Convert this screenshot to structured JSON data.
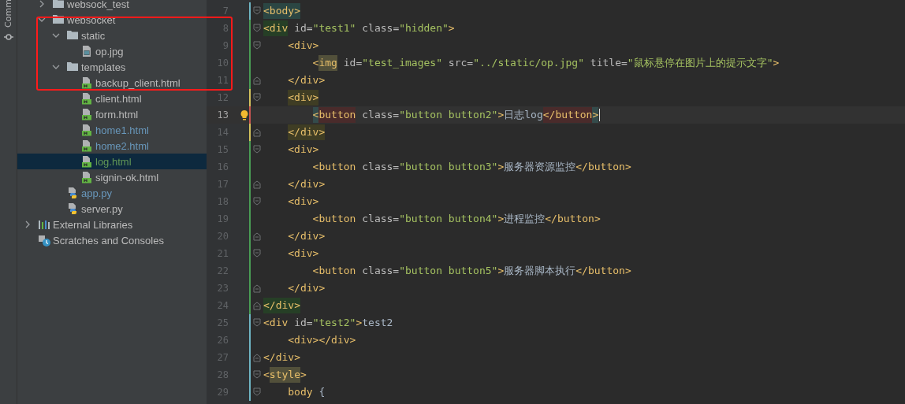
{
  "tool_strip": {
    "tab_label": "Comm"
  },
  "project_tree": {
    "items": [
      {
        "label": "websock_test",
        "kind": "folder",
        "expanded": false,
        "selected": false
      },
      {
        "label": "websocket",
        "kind": "folder",
        "expanded": true,
        "selected": false,
        "children": [
          {
            "label": "static",
            "kind": "folder",
            "expanded": true,
            "selected": false,
            "children": [
              {
                "label": "op.jpg",
                "kind": "image",
                "selected": false
              }
            ]
          },
          {
            "label": "templates",
            "kind": "folder",
            "expanded": true,
            "selected": false,
            "children": [
              {
                "label": "backup_client.html",
                "kind": "html",
                "selected": false
              },
              {
                "label": "client.html",
                "kind": "html",
                "selected": false
              },
              {
                "label": "form.html",
                "kind": "html",
                "selected": false
              },
              {
                "label": "home1.html",
                "kind": "html",
                "color": "#6897bb",
                "selected": false
              },
              {
                "label": "home2.html",
                "kind": "html",
                "color": "#6897bb",
                "selected": false
              },
              {
                "label": "log.html",
                "kind": "html",
                "color": "#629755",
                "selected": true
              },
              {
                "label": "signin-ok.html",
                "kind": "html",
                "selected": false
              }
            ]
          },
          {
            "label": "app.py",
            "kind": "python",
            "color": "#6897bb",
            "selected": false
          },
          {
            "label": "server.py",
            "kind": "python",
            "selected": false
          }
        ]
      },
      {
        "label": "External Libraries",
        "kind": "libraries",
        "expanded": false,
        "selected": false
      },
      {
        "label": "Scratches and Consoles",
        "kind": "scratches",
        "selected": false
      }
    ]
  },
  "annotation": {
    "kind": "rectangle"
  },
  "editor": {
    "lines": [
      {
        "number": "7",
        "color": "#6fb5c4",
        "fold_start": true,
        "current": false,
        "tokens": [
          {
            "kind": "tag",
            "s": "<body>",
            "color": "#2b4643"
          }
        ]
      },
      {
        "number": "8",
        "color": "#499c54",
        "fold_start": true,
        "current": false,
        "tokens": [
          {
            "kind": "tag",
            "s": "<div",
            "color": "#263f26"
          },
          {
            "kind": "attr",
            "s": " id="
          },
          {
            "kind": "str",
            "s": "\"test1\""
          },
          {
            "kind": "attr",
            "s": " class="
          },
          {
            "kind": "str",
            "s": "\"hidden\""
          },
          {
            "kind": "tag",
            "s": ">"
          }
        ],
        "children": [
          {
            "number": "9",
            "color": "#499c54",
            "fold_start": true,
            "current": false,
            "tokens": [
              {
                "kind": "tag",
                "s": "<div>"
              }
            ],
            "children": [
              {
                "number": "10",
                "color": "#499c54",
                "current": false,
                "tokens": [
                  {
                    "kind": "tag",
                    "s": "<"
                  },
                  {
                    "kind": "tag",
                    "s": "img",
                    "color": "#52503a"
                  },
                  {
                    "kind": "attr",
                    "s": " id="
                  },
                  {
                    "kind": "str",
                    "s": "\"test_images\""
                  },
                  {
                    "kind": "attr",
                    "s": " src="
                  },
                  {
                    "kind": "str",
                    "s": "\"../static/op.jpg\""
                  },
                  {
                    "kind": "attr",
                    "s": " title="
                  },
                  {
                    "kind": "str",
                    "s": "\"鼠标悬停在图片上的提示文字\""
                  },
                  {
                    "kind": "tag",
                    "s": ">"
                  }
                ]
              }
            ]
          },
          {
            "number": "11",
            "color": "#499c54",
            "fold_end": true,
            "current": false,
            "tokens": [
              {
                "kind": "tag",
                "s": "</div>"
              }
            ]
          },
          {
            "number": "12",
            "color": "#d3c25d",
            "fold_start": true,
            "current": false,
            "tokens": [
              {
                "kind": "tag",
                "s": "<div>",
                "color": "#3f3d24"
              }
            ],
            "children": [
              {
                "number": "13",
                "color": "#c75450",
                "current": true,
                "hint": true,
                "tokens": [
                  {
                    "kind": "tag",
                    "s": "<",
                    "color": "#344b4b"
                  },
                  {
                    "kind": "tag",
                    "s": "button",
                    "color": "#4a2b2b"
                  },
                  {
                    "kind": "attr",
                    "s": " class="
                  },
                  {
                    "kind": "str",
                    "s": "\"button button2\""
                  },
                  {
                    "kind": "tag",
                    "s": ">"
                  },
                  {
                    "kind": "text",
                    "s": "日志log"
                  },
                  {
                    "kind": "tag",
                    "s": "</button",
                    "color": "#4a2b2b"
                  },
                  {
                    "kind": "tag",
                    "s": ">",
                    "color": "#344b4b"
                  }
                ]
              }
            ]
          },
          {
            "number": "14",
            "color": "#d3c25d",
            "fold_end": true,
            "current": false,
            "tokens": [
              {
                "kind": "tag",
                "s": "</div>",
                "color": "#3f3d24"
              }
            ]
          },
          {
            "number": "15",
            "color": "#499c54",
            "fold_start": true,
            "current": false,
            "tokens": [
              {
                "kind": "tag",
                "s": "<div>"
              }
            ],
            "children": [
              {
                "number": "16",
                "color": "#499c54",
                "current": false,
                "tokens": [
                  {
                    "kind": "tag",
                    "s": "<button"
                  },
                  {
                    "kind": "attr",
                    "s": " class="
                  },
                  {
                    "kind": "str",
                    "s": "\"button button3\""
                  },
                  {
                    "kind": "tag",
                    "s": ">"
                  },
                  {
                    "kind": "text",
                    "s": "服务器资源监控"
                  },
                  {
                    "kind": "tag",
                    "s": "</button>"
                  }
                ]
              }
            ]
          },
          {
            "number": "17",
            "color": "#499c54",
            "fold_end": true,
            "current": false,
            "tokens": [
              {
                "kind": "tag",
                "s": "</div>"
              }
            ]
          },
          {
            "number": "18",
            "color": "#499c54",
            "fold_start": true,
            "current": false,
            "tokens": [
              {
                "kind": "tag",
                "s": "<div>"
              }
            ],
            "children": [
              {
                "number": "19",
                "color": "#499c54",
                "current": false,
                "tokens": [
                  {
                    "kind": "tag",
                    "s": "<button"
                  },
                  {
                    "kind": "attr",
                    "s": " class="
                  },
                  {
                    "kind": "str",
                    "s": "\"button button4\""
                  },
                  {
                    "kind": "tag",
                    "s": ">"
                  },
                  {
                    "kind": "text",
                    "s": "进程监控"
                  },
                  {
                    "kind": "tag",
                    "s": "</button>"
                  }
                ]
              }
            ]
          },
          {
            "number": "20",
            "color": "#499c54",
            "fold_end": true,
            "current": false,
            "tokens": [
              {
                "kind": "tag",
                "s": "</div>"
              }
            ]
          },
          {
            "number": "21",
            "color": "#499c54",
            "fold_start": true,
            "current": false,
            "tokens": [
              {
                "kind": "tag",
                "s": "<div>"
              }
            ],
            "children": [
              {
                "number": "22",
                "color": "#499c54",
                "current": false,
                "tokens": [
                  {
                    "kind": "tag",
                    "s": "<button"
                  },
                  {
                    "kind": "attr",
                    "s": " class="
                  },
                  {
                    "kind": "str",
                    "s": "\"button button5\""
                  },
                  {
                    "kind": "tag",
                    "s": ">"
                  },
                  {
                    "kind": "text",
                    "s": "服务器脚本执行"
                  },
                  {
                    "kind": "tag",
                    "s": "</button>"
                  }
                ]
              }
            ]
          },
          {
            "number": "23",
            "color": "#499c54",
            "fold_end": true,
            "current": false,
            "tokens": [
              {
                "kind": "tag",
                "s": "</div>"
              }
            ]
          }
        ]
      },
      {
        "number": "24",
        "color": "#499c54",
        "fold_end": true,
        "current": false,
        "tokens": [
          {
            "kind": "tag",
            "s": "</div>",
            "color": "#263f26"
          }
        ]
      },
      {
        "number": "25",
        "color": "#6fb5c4",
        "fold_start": true,
        "current": false,
        "tokens": [
          {
            "kind": "tag",
            "s": "<div"
          },
          {
            "kind": "attr",
            "s": " id="
          },
          {
            "kind": "str",
            "s": "\"test2\""
          },
          {
            "kind": "tag",
            "s": ">"
          },
          {
            "kind": "text",
            "s": "test2"
          }
        ],
        "children": [
          {
            "number": "26",
            "color": "#6fb5c4",
            "current": false,
            "tokens": [
              {
                "kind": "tag",
                "s": "<div></div>"
              }
            ]
          }
        ]
      },
      {
        "number": "27",
        "color": "#6fb5c4",
        "fold_end": true,
        "current": false,
        "tokens": [
          {
            "kind": "tag",
            "s": "</div>"
          }
        ]
      },
      {
        "number": "28",
        "color": "#6fb5c4",
        "fold_start": true,
        "current": false,
        "tokens": [
          {
            "kind": "tag",
            "s": "<"
          },
          {
            "kind": "tag",
            "s": "style",
            "color": "#52503a"
          },
          {
            "kind": "tag",
            "s": ">"
          }
        ],
        "children": [
          {
            "number": "29",
            "color": "#6fb5c4",
            "fold_start": true,
            "current": false,
            "tokens": [
              {
                "kind": "tag",
                "s": "body"
              },
              {
                "kind": "text",
                "s": " {"
              }
            ]
          }
        ]
      }
    ]
  }
}
